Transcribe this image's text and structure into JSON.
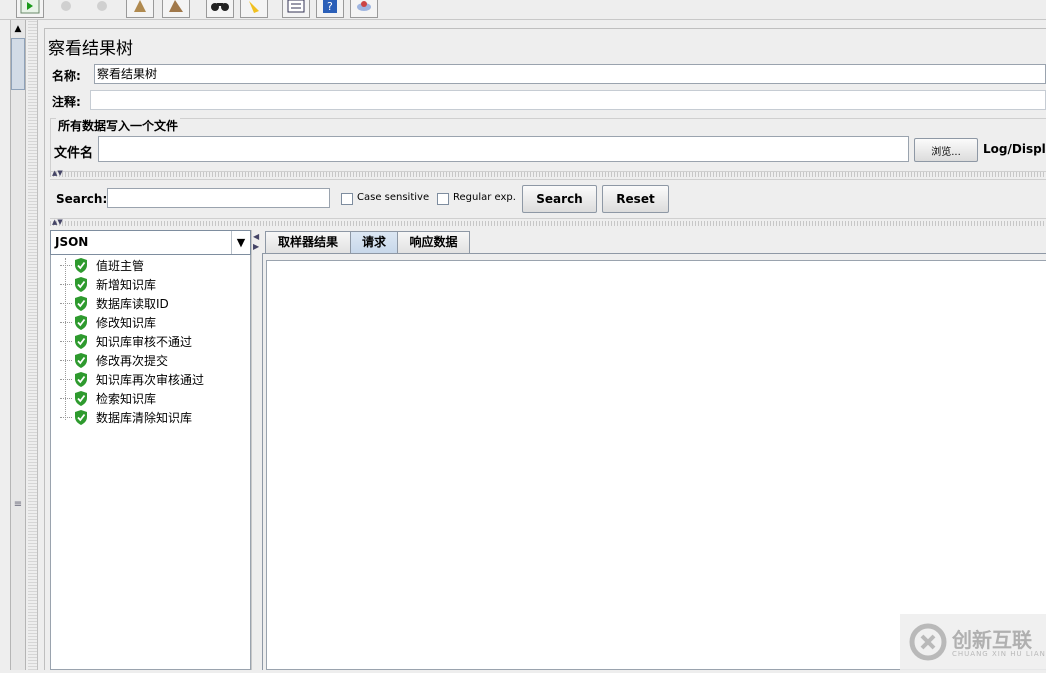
{
  "toolbar": {
    "buttons": [
      {
        "icon": "run-icon",
        "enabled": true
      },
      {
        "icon": "stop-icon",
        "enabled": false
      },
      {
        "icon": "shutdown-icon",
        "enabled": false
      },
      {
        "icon": "clear-icon",
        "enabled": true
      },
      {
        "icon": "clear-all-icon",
        "enabled": true
      },
      {
        "icon": "binoculars-search-icon",
        "enabled": true
      },
      {
        "icon": "broom-reset-icon",
        "enabled": true
      },
      {
        "icon": "function-helper-icon",
        "enabled": true
      },
      {
        "icon": "help-icon",
        "enabled": true
      },
      {
        "icon": "remote-icon",
        "enabled": true
      }
    ]
  },
  "panel": {
    "title": "察看结果树",
    "name_label": "名称:",
    "name_value": "察看结果树",
    "comment_label": "注释:",
    "comment_value": "",
    "file_group_title": "所有数据写入一个文件",
    "filename_label": "文件名",
    "filename_value": "",
    "browse_label": "浏览...",
    "log_display_label": "Log/Display"
  },
  "search": {
    "label": "Search:",
    "value": "",
    "case_sensitive_label": "Case sensitive",
    "case_sensitive_checked": false,
    "regex_label": "Regular exp.",
    "regex_checked": false,
    "search_button": "Search",
    "reset_button": "Reset"
  },
  "renderer": {
    "selected": "JSON"
  },
  "tree": {
    "items": [
      {
        "label": "值班主管",
        "status": "success"
      },
      {
        "label": "新增知识库",
        "status": "success"
      },
      {
        "label": "数据库读取ID",
        "status": "success"
      },
      {
        "label": "修改知识库",
        "status": "success"
      },
      {
        "label": "知识库审核不通过",
        "status": "success"
      },
      {
        "label": "修改再次提交",
        "status": "success"
      },
      {
        "label": "知识库再次审核通过",
        "status": "success"
      },
      {
        "label": "检索知识库",
        "status": "success"
      },
      {
        "label": "数据库清除知识库",
        "status": "success"
      }
    ]
  },
  "tabs": {
    "items": [
      {
        "label": "取样器结果",
        "selected": false
      },
      {
        "label": "请求",
        "selected": true
      },
      {
        "label": "响应数据",
        "selected": false
      }
    ]
  },
  "watermark": {
    "text": "创新互联",
    "subtext": "CHUANG XIN HU LIAN"
  },
  "colors": {
    "success_green": "#2e9a2e",
    "selected_tab": "#c7d7ea",
    "panel_bg": "#eeeeee"
  }
}
